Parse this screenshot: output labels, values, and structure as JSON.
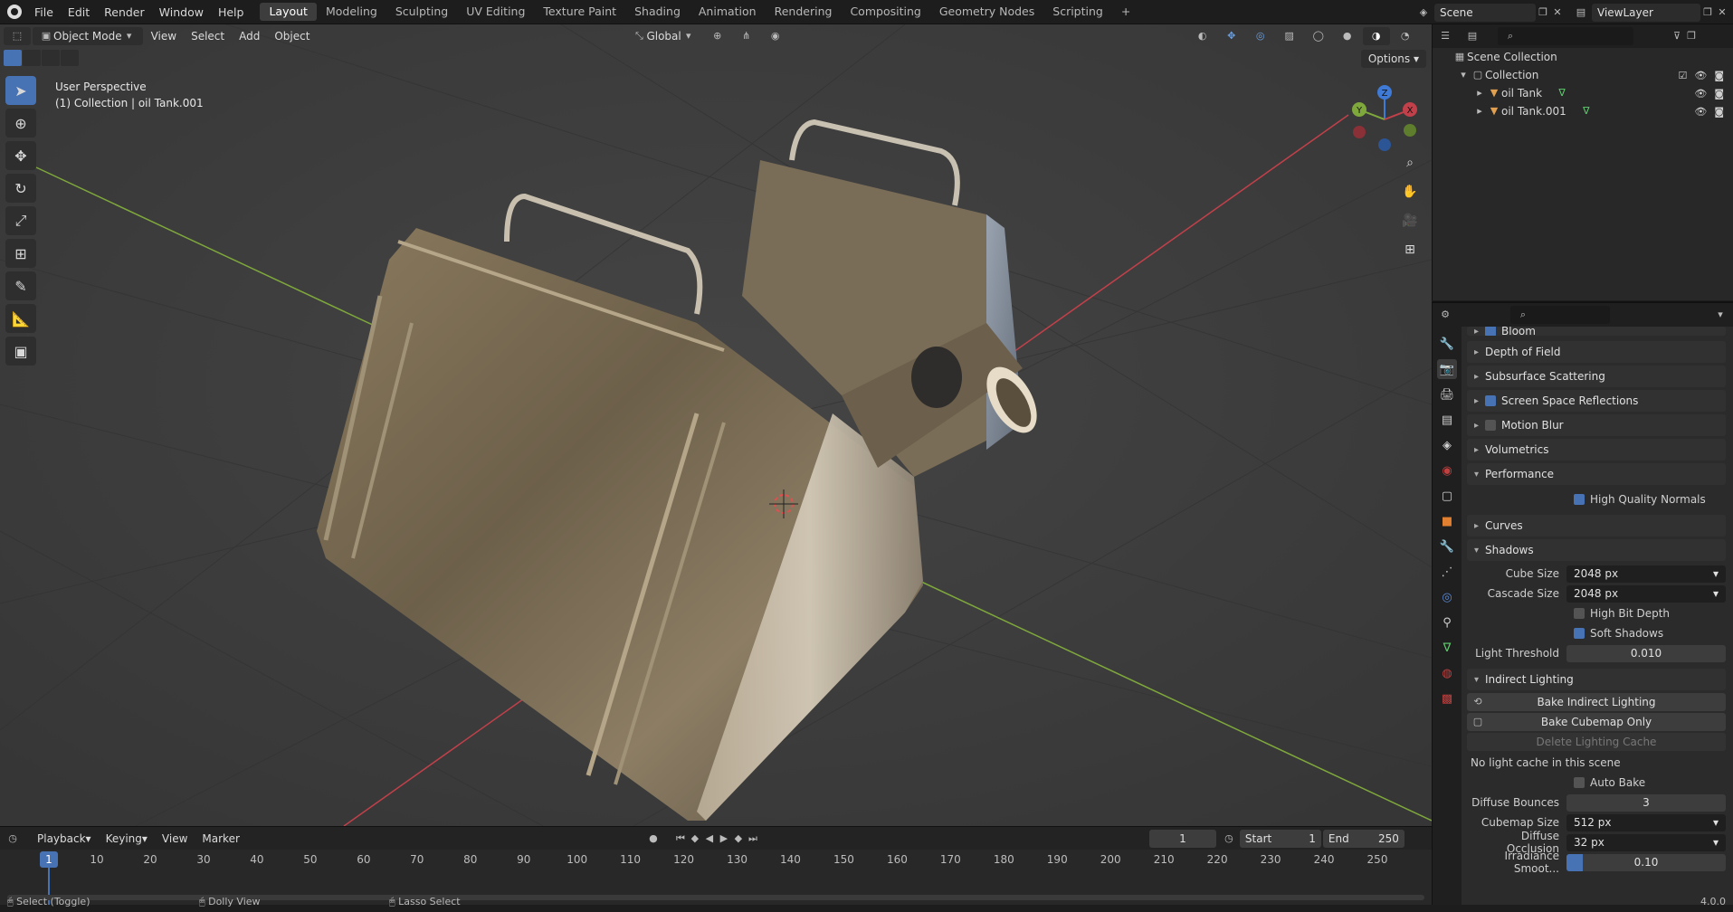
{
  "topbar": {
    "menus": [
      "File",
      "Edit",
      "Render",
      "Window",
      "Help"
    ],
    "workspaces": [
      "Layout",
      "Modeling",
      "Sculpting",
      "UV Editing",
      "Texture Paint",
      "Shading",
      "Animation",
      "Rendering",
      "Compositing",
      "Geometry Nodes",
      "Scripting"
    ],
    "active_workspace": "Layout",
    "add_tab": "+",
    "scene": "Scene",
    "view_layer": "ViewLayer"
  },
  "viewport": {
    "mode": "Object Mode",
    "menus": [
      "View",
      "Select",
      "Add",
      "Object"
    ],
    "transform_orientation": "Global",
    "options": "Options",
    "overlay_line1": "User Perspective",
    "overlay_line2": "(1) Collection | oil Tank.001",
    "gizmo_axes": {
      "x": "X",
      "y": "Y",
      "z": "Z"
    },
    "colors": {
      "background": "#3c3c3c",
      "x_axis": "#c2404a",
      "y_axis": "#7fa83c",
      "z_axis": "#3f7ad6",
      "accent": "#4772b3"
    }
  },
  "outliner": {
    "root": "Scene Collection",
    "collection": "Collection",
    "items": [
      "oil Tank",
      "oil Tank.001"
    ]
  },
  "properties": {
    "sections": [
      {
        "label": "Bloom",
        "collapsed": true,
        "checkbox": true
      },
      {
        "label": "Depth of Field",
        "collapsed": true
      },
      {
        "label": "Subsurface Scattering",
        "collapsed": true
      },
      {
        "label": "Screen Space Reflections",
        "collapsed": true,
        "checkbox": true
      },
      {
        "label": "Motion Blur",
        "collapsed": true,
        "checkbox": false
      },
      {
        "label": "Volumetrics",
        "collapsed": true
      },
      {
        "label": "Performance",
        "collapsed": false
      }
    ],
    "performance": {
      "high_quality_normals": "High Quality Normals"
    },
    "curves": "Curves",
    "shadows": {
      "label": "Shadows",
      "cube_size_label": "Cube Size",
      "cube_size": "2048 px",
      "cascade_size_label": "Cascade Size",
      "cascade_size": "2048 px",
      "high_bit_depth": "High Bit Depth",
      "soft_shadows": "Soft Shadows",
      "light_threshold_label": "Light Threshold",
      "light_threshold": "0.010"
    },
    "indirect": {
      "label": "Indirect Lighting",
      "bake_indirect": "Bake Indirect Lighting",
      "bake_cubemap": "Bake Cubemap Only",
      "delete_cache": "Delete Lighting Cache",
      "no_cache": "No light cache in this scene",
      "auto_bake": "Auto Bake",
      "diffuse_bounces_label": "Diffuse Bounces",
      "diffuse_bounces": "3",
      "cubemap_size_label": "Cubemap Size",
      "cubemap_size": "512 px",
      "diffuse_occlusion_label": "Diffuse Occlusion",
      "diffuse_occlusion": "32 px",
      "irradiance_smooth_label": "Irradiance Smoot...",
      "irradiance_smooth": "0.10",
      "irradiance_fill": 0.1
    }
  },
  "timeline": {
    "menus": [
      "Playback",
      "Keying",
      "View",
      "Marker"
    ],
    "current_frame": "1",
    "start_label": "Start",
    "start": "1",
    "end_label": "End",
    "end": "250",
    "ticks": [
      "1",
      "10",
      "20",
      "30",
      "40",
      "50",
      "60",
      "70",
      "80",
      "90",
      "100",
      "110",
      "120",
      "130",
      "140",
      "150",
      "160",
      "170",
      "180",
      "190",
      "200",
      "210",
      "220",
      "230",
      "240",
      "250"
    ]
  },
  "statusbar": {
    "left": "Select (Toggle)",
    "middle": "Dolly View",
    "right": "Lasso Select",
    "version": "4.0.0"
  }
}
